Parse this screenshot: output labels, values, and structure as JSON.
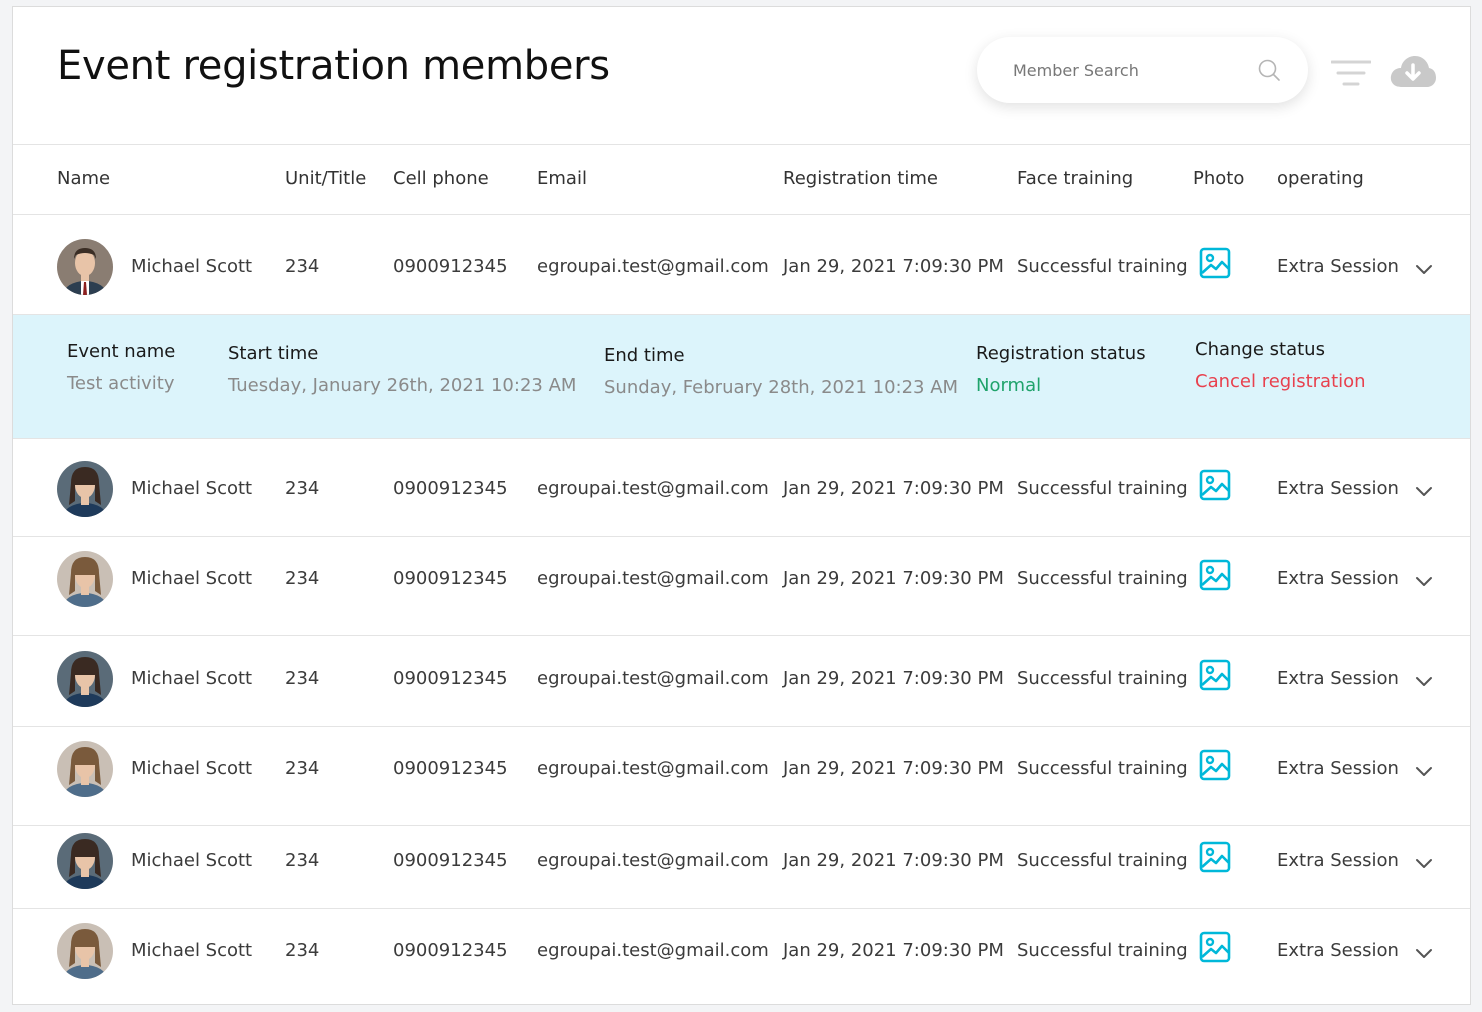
{
  "page": {
    "title": "Event registration members"
  },
  "search": {
    "placeholder": "Member Search"
  },
  "toolbar": {
    "search_icon": "search-icon",
    "filter_icon": "filter-icon",
    "download_icon": "cloud-download-icon",
    "accent": "#00b8d9"
  },
  "table": {
    "columns": [
      "Name",
      "Unit/Title",
      "Cell phone",
      "Email",
      "Registration time",
      "Face training",
      "Photo",
      "operating"
    ],
    "rows": [
      {
        "name": "Michael Scott",
        "unit": "234",
        "phone": "0900912345",
        "email": "egroupai.test@gmail.com",
        "time": "Jan 29, 2021 7:09:30 PM",
        "training": "Successful training",
        "operating": "Extra Session",
        "avatar": "man"
      },
      {
        "name": "Michael Scott",
        "unit": "234",
        "phone": "0900912345",
        "email": "egroupai.test@gmail.com",
        "time": "Jan 29, 2021 7:09:30 PM",
        "training": "Successful training",
        "operating": "Extra Session",
        "avatar": "woman-dark"
      },
      {
        "name": "Michael Scott",
        "unit": "234",
        "phone": "0900912345",
        "email": "egroupai.test@gmail.com",
        "time": "Jan 29, 2021 7:09:30 PM",
        "training": "Successful training",
        "operating": "Extra Session",
        "avatar": "woman-light"
      },
      {
        "name": "Michael Scott",
        "unit": "234",
        "phone": "0900912345",
        "email": "egroupai.test@gmail.com",
        "time": "Jan 29, 2021 7:09:30 PM",
        "training": "Successful training",
        "operating": "Extra Session",
        "avatar": "woman-dark"
      },
      {
        "name": "Michael Scott",
        "unit": "234",
        "phone": "0900912345",
        "email": "egroupai.test@gmail.com",
        "time": "Jan 29, 2021 7:09:30 PM",
        "training": "Successful training",
        "operating": "Extra Session",
        "avatar": "woman-light"
      },
      {
        "name": "Michael Scott",
        "unit": "234",
        "phone": "0900912345",
        "email": "egroupai.test@gmail.com",
        "time": "Jan 29, 2021 7:09:30 PM",
        "training": "Successful training",
        "operating": "Extra Session",
        "avatar": "woman-dark"
      },
      {
        "name": "Michael Scott",
        "unit": "234",
        "phone": "0900912345",
        "email": "egroupai.test@gmail.com",
        "time": "Jan 29, 2021 7:09:30 PM",
        "training": "Successful training",
        "operating": "Extra Session",
        "avatar": "woman-light"
      }
    ]
  },
  "detail": {
    "event_name_label": "Event name",
    "event_name": "Test activity",
    "start_label": "Start time",
    "start_time": "Tuesday, January 26th, 2021 10:23 AM",
    "end_label": "End time",
    "end_time": "Sunday, February 28th, 2021 10:23 AM",
    "status_label": "Registration status",
    "status": "Normal",
    "change_label": "Change status",
    "change_action": "Cancel registration",
    "colors": {
      "background": "#dcf4fb",
      "status": "#1fa36b",
      "action": "#e8414e"
    }
  }
}
